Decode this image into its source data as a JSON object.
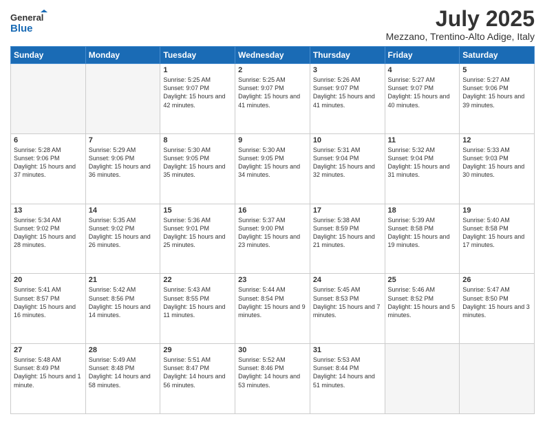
{
  "header": {
    "logo_line1": "General",
    "logo_line2": "Blue",
    "month_title": "July 2025",
    "location": "Mezzano, Trentino-Alto Adige, Italy"
  },
  "days_of_week": [
    "Sunday",
    "Monday",
    "Tuesday",
    "Wednesday",
    "Thursday",
    "Friday",
    "Saturday"
  ],
  "weeks": [
    [
      {
        "day": "",
        "empty": true
      },
      {
        "day": "",
        "empty": true
      },
      {
        "day": "1",
        "sunrise": "5:25 AM",
        "sunset": "9:07 PM",
        "daylight": "15 hours and 42 minutes."
      },
      {
        "day": "2",
        "sunrise": "5:25 AM",
        "sunset": "9:07 PM",
        "daylight": "15 hours and 41 minutes."
      },
      {
        "day": "3",
        "sunrise": "5:26 AM",
        "sunset": "9:07 PM",
        "daylight": "15 hours and 41 minutes."
      },
      {
        "day": "4",
        "sunrise": "5:27 AM",
        "sunset": "9:07 PM",
        "daylight": "15 hours and 40 minutes."
      },
      {
        "day": "5",
        "sunrise": "5:27 AM",
        "sunset": "9:06 PM",
        "daylight": "15 hours and 39 minutes."
      }
    ],
    [
      {
        "day": "6",
        "sunrise": "5:28 AM",
        "sunset": "9:06 PM",
        "daylight": "15 hours and 37 minutes."
      },
      {
        "day": "7",
        "sunrise": "5:29 AM",
        "sunset": "9:06 PM",
        "daylight": "15 hours and 36 minutes."
      },
      {
        "day": "8",
        "sunrise": "5:30 AM",
        "sunset": "9:05 PM",
        "daylight": "15 hours and 35 minutes."
      },
      {
        "day": "9",
        "sunrise": "5:30 AM",
        "sunset": "9:05 PM",
        "daylight": "15 hours and 34 minutes."
      },
      {
        "day": "10",
        "sunrise": "5:31 AM",
        "sunset": "9:04 PM",
        "daylight": "15 hours and 32 minutes."
      },
      {
        "day": "11",
        "sunrise": "5:32 AM",
        "sunset": "9:04 PM",
        "daylight": "15 hours and 31 minutes."
      },
      {
        "day": "12",
        "sunrise": "5:33 AM",
        "sunset": "9:03 PM",
        "daylight": "15 hours and 30 minutes."
      }
    ],
    [
      {
        "day": "13",
        "sunrise": "5:34 AM",
        "sunset": "9:02 PM",
        "daylight": "15 hours and 28 minutes."
      },
      {
        "day": "14",
        "sunrise": "5:35 AM",
        "sunset": "9:02 PM",
        "daylight": "15 hours and 26 minutes."
      },
      {
        "day": "15",
        "sunrise": "5:36 AM",
        "sunset": "9:01 PM",
        "daylight": "15 hours and 25 minutes."
      },
      {
        "day": "16",
        "sunrise": "5:37 AM",
        "sunset": "9:00 PM",
        "daylight": "15 hours and 23 minutes."
      },
      {
        "day": "17",
        "sunrise": "5:38 AM",
        "sunset": "8:59 PM",
        "daylight": "15 hours and 21 minutes."
      },
      {
        "day": "18",
        "sunrise": "5:39 AM",
        "sunset": "8:58 PM",
        "daylight": "15 hours and 19 minutes."
      },
      {
        "day": "19",
        "sunrise": "5:40 AM",
        "sunset": "8:58 PM",
        "daylight": "15 hours and 17 minutes."
      }
    ],
    [
      {
        "day": "20",
        "sunrise": "5:41 AM",
        "sunset": "8:57 PM",
        "daylight": "15 hours and 16 minutes."
      },
      {
        "day": "21",
        "sunrise": "5:42 AM",
        "sunset": "8:56 PM",
        "daylight": "15 hours and 14 minutes."
      },
      {
        "day": "22",
        "sunrise": "5:43 AM",
        "sunset": "8:55 PM",
        "daylight": "15 hours and 11 minutes."
      },
      {
        "day": "23",
        "sunrise": "5:44 AM",
        "sunset": "8:54 PM",
        "daylight": "15 hours and 9 minutes."
      },
      {
        "day": "24",
        "sunrise": "5:45 AM",
        "sunset": "8:53 PM",
        "daylight": "15 hours and 7 minutes."
      },
      {
        "day": "25",
        "sunrise": "5:46 AM",
        "sunset": "8:52 PM",
        "daylight": "15 hours and 5 minutes."
      },
      {
        "day": "26",
        "sunrise": "5:47 AM",
        "sunset": "8:50 PM",
        "daylight": "15 hours and 3 minutes."
      }
    ],
    [
      {
        "day": "27",
        "sunrise": "5:48 AM",
        "sunset": "8:49 PM",
        "daylight": "15 hours and 1 minute."
      },
      {
        "day": "28",
        "sunrise": "5:49 AM",
        "sunset": "8:48 PM",
        "daylight": "14 hours and 58 minutes."
      },
      {
        "day": "29",
        "sunrise": "5:51 AM",
        "sunset": "8:47 PM",
        "daylight": "14 hours and 56 minutes."
      },
      {
        "day": "30",
        "sunrise": "5:52 AM",
        "sunset": "8:46 PM",
        "daylight": "14 hours and 53 minutes."
      },
      {
        "day": "31",
        "sunrise": "5:53 AM",
        "sunset": "8:44 PM",
        "daylight": "14 hours and 51 minutes."
      },
      {
        "day": "",
        "empty": true
      },
      {
        "day": "",
        "empty": true
      }
    ]
  ]
}
